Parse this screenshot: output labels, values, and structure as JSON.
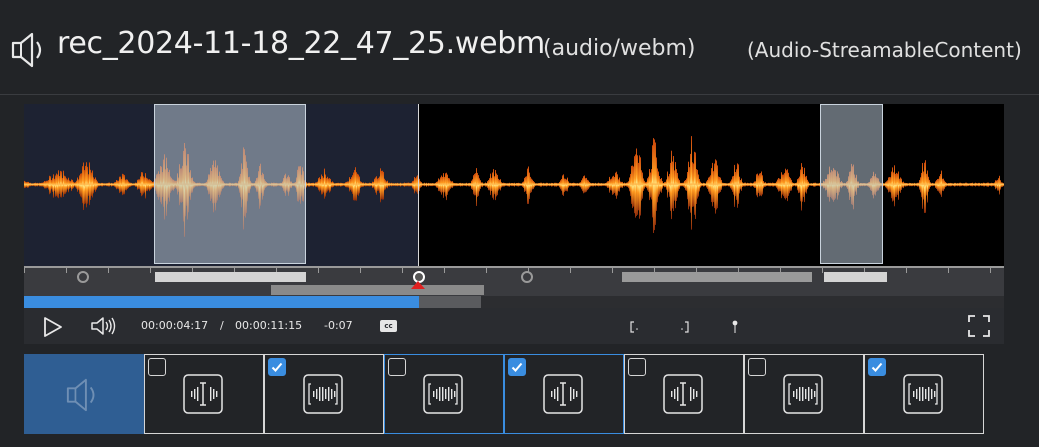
{
  "header": {
    "filename": "rec_2024-11-18_22_47_25.webm",
    "mime": "(audio/webm)",
    "content_type": "(Audio-StreamableContent)"
  },
  "player": {
    "current_time": "00:00:04:17",
    "separator": "/",
    "duration": "00:00:11:15",
    "offset": "-0:07",
    "cc_label": "cc",
    "played_fraction": 0.403
  },
  "thumbnails": [
    {
      "type": "audio-preview",
      "selected": true
    },
    {
      "type": "waveform-trim",
      "checked": false,
      "active": false
    },
    {
      "type": "waveform-bracket",
      "checked": true,
      "active": false
    },
    {
      "type": "waveform-bracket",
      "checked": false,
      "active": true
    },
    {
      "type": "waveform-trim",
      "checked": true,
      "active": true
    },
    {
      "type": "waveform-trim",
      "checked": false,
      "active": false
    },
    {
      "type": "waveform-bracket",
      "checked": false,
      "active": false
    },
    {
      "type": "waveform-bracket",
      "checked": true,
      "active": false
    }
  ],
  "colors": {
    "accent": "#3a8de0",
    "waveform_core": "#ffd24a",
    "waveform_edge": "#d45a10",
    "background": "#222427"
  },
  "icons": {
    "header": "speaker-icon",
    "play": "play-icon",
    "volume": "volume-icon",
    "cc": "closed-captions-icon",
    "mark_in": "mark-in-icon",
    "mark_out": "mark-out-icon",
    "marker": "marker-pin-icon",
    "fullscreen": "fullscreen-icon"
  }
}
